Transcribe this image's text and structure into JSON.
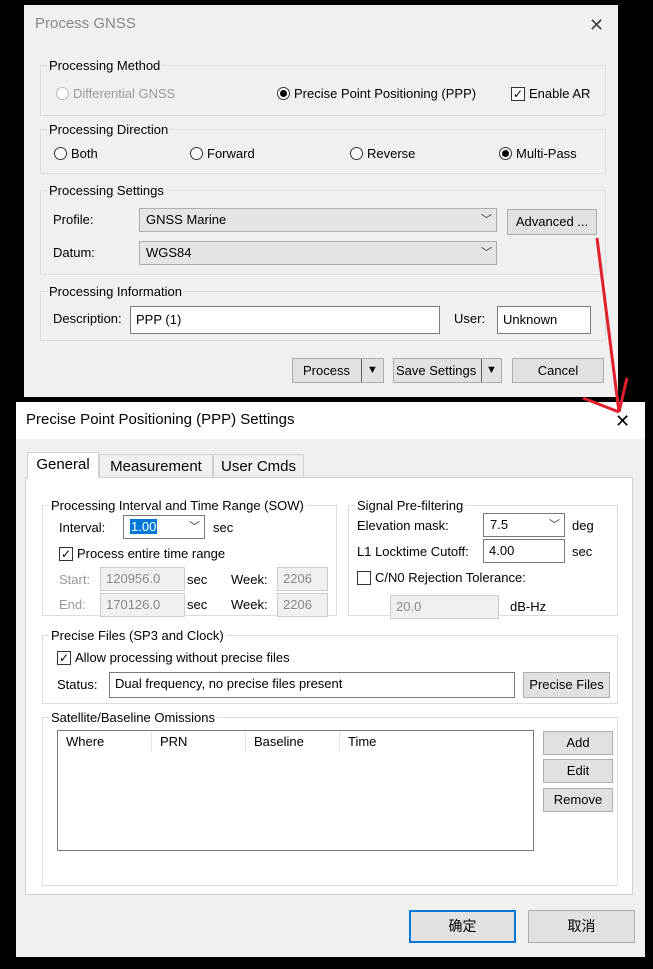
{
  "gnss": {
    "title": "Process GNSS",
    "close": "✕",
    "method": {
      "legend": "Processing Method",
      "differential": "Differential GNSS",
      "ppp": "Precise Point Positioning (PPP)",
      "enable_ar": "Enable AR"
    },
    "direction": {
      "legend": "Processing Direction",
      "both": "Both",
      "forward": "Forward",
      "reverse": "Reverse",
      "multipass": "Multi-Pass"
    },
    "settings": {
      "legend": "Processing Settings",
      "profile_label": "Profile:",
      "profile_value": "GNSS Marine",
      "advanced": "Advanced ...",
      "datum_label": "Datum:",
      "datum_value": "WGS84"
    },
    "info": {
      "legend": "Processing Information",
      "desc_label": "Description:",
      "desc_value": "PPP (1)",
      "user_label": "User:",
      "user_value": "Unknown"
    },
    "buttons": {
      "process": "Process",
      "save": "Save Settings",
      "cancel": "Cancel"
    }
  },
  "ppp": {
    "title": "Precise Point Positioning (PPP) Settings",
    "close": "✕",
    "tabs": [
      "General",
      "Measurement",
      "User Cmds"
    ],
    "interval": {
      "legend": "Processing Interval and Time Range (SOW)",
      "interval_label": "Interval:",
      "interval_value": "1.00",
      "sec": "sec",
      "entire": "Process entire time range",
      "start_label": "Start:",
      "start_value": "120956.0",
      "end_label": "End:",
      "end_value": "170126.0",
      "week_label": "Week:",
      "week_start": "2206",
      "week_end": "2206"
    },
    "signal": {
      "legend": "Signal Pre-filtering",
      "elev_label": "Elevation mask:",
      "elev_value": "7.5",
      "deg": "deg",
      "lock_label": "L1 Locktime Cutoff:",
      "lock_value": "4.00",
      "sec": "sec",
      "cn0_label": "C/N0 Rejection Tolerance:",
      "cn0_value": "20.0",
      "dbhz": "dB-Hz"
    },
    "precise": {
      "legend": "Precise Files (SP3 and Clock)",
      "allow": "Allow processing without precise files",
      "status_label": "Status:",
      "status_value": "Dual frequency, no precise files present",
      "button": "Precise Files"
    },
    "omissions": {
      "legend": "Satellite/Baseline Omissions",
      "columns": [
        "Where",
        "PRN",
        "Baseline",
        "Time"
      ],
      "add": "Add",
      "edit": "Edit",
      "remove": "Remove"
    },
    "ok": "确定",
    "cancel": "取消"
  },
  "colors": {
    "annotation_arrow": "#e0202a",
    "primary_border": "#0078d7"
  }
}
